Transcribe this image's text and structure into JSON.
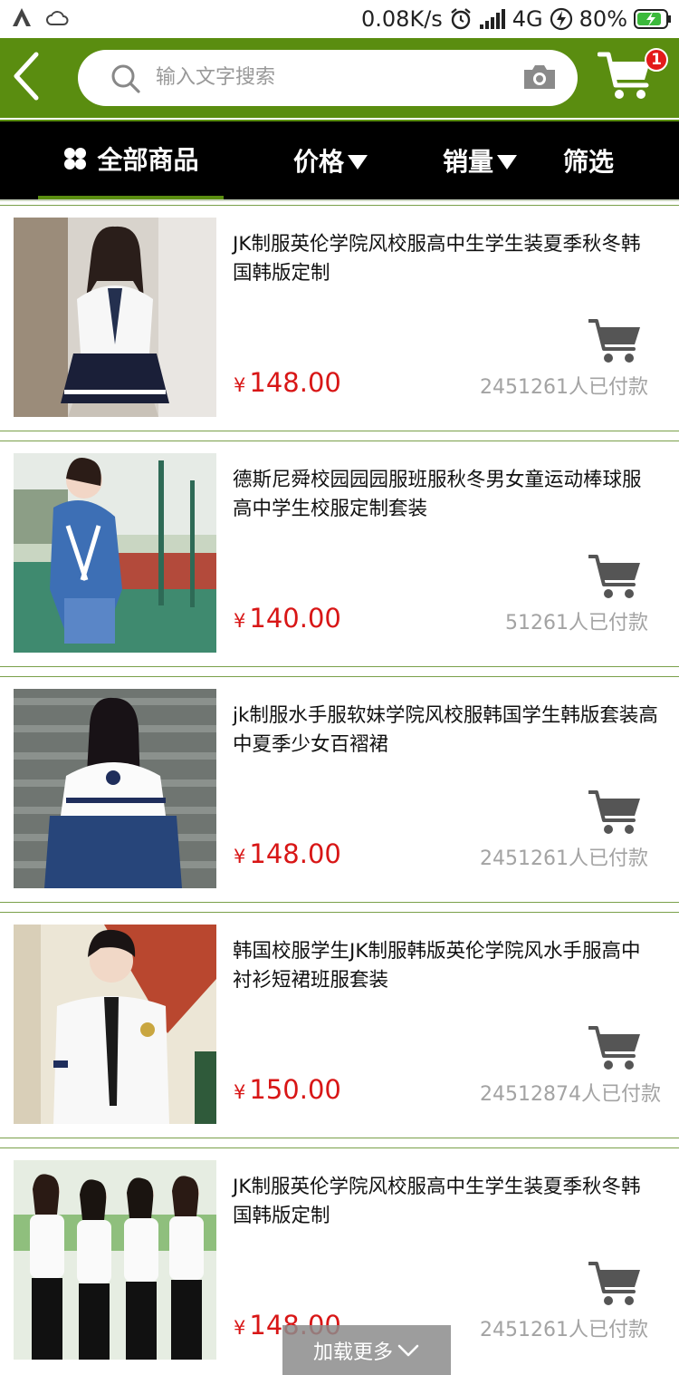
{
  "status_bar": {
    "network_speed": "0.08K/s",
    "network_type": "4G",
    "battery": "80%",
    "icons": [
      "app-icon",
      "weather-icon",
      "alarm-icon",
      "signal-icon",
      "charging-icon",
      "battery-icon"
    ]
  },
  "header": {
    "search_placeholder": "输入文字搜索",
    "cart_badge": "1",
    "brand_color": "#5a8d10"
  },
  "filters": {
    "all": "全部商品",
    "price": "价格",
    "sales": "销量",
    "filter": "筛选"
  },
  "products": [
    {
      "title": "JK制服英伦学院风校服高中生学生装夏季秋冬韩国韩版定制",
      "currency": "¥",
      "price": "148.00",
      "sold": "2451261人已付款"
    },
    {
      "title": "德斯尼舜校园园园服班服秋冬男女童运动棒球服高中学生校服定制套装",
      "currency": "¥",
      "price": "140.00",
      "sold": "51261人已付款"
    },
    {
      "title": "jk制服水手服软妹学院风校服韩国学生韩版套装高中夏季少女百褶裙",
      "currency": "¥",
      "price": "148.00",
      "sold": "2451261人已付款"
    },
    {
      "title": "韩国校服学生JK制服韩版英伦学院风水手服高中衬衫短裙班服套装",
      "currency": "¥",
      "price": "150.00",
      "sold": "24512874人已付款"
    },
    {
      "title": "JK制服英伦学院风校服高中生学生装夏季秋冬韩国韩版定制",
      "currency": "¥",
      "price": "148.00",
      "sold": "2451261人已付款"
    }
  ],
  "load_more": "加载更多",
  "colors": {
    "accent": "#5a8d10",
    "price": "#d81616",
    "tab_bar": "#000000"
  }
}
